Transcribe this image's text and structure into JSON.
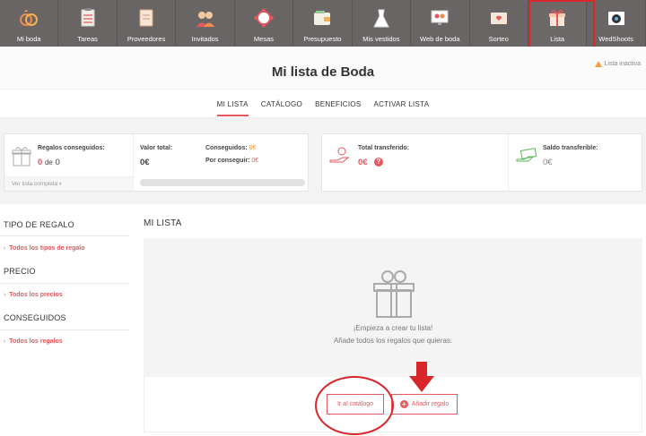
{
  "nav": {
    "items": [
      {
        "label": "Mi boda",
        "icon": "rings-icon"
      },
      {
        "label": "Tareas",
        "icon": "checklist-icon"
      },
      {
        "label": "Proveedores",
        "icon": "notebook-icon"
      },
      {
        "label": "Invitados",
        "icon": "guests-icon"
      },
      {
        "label": "Mesas",
        "icon": "table-icon"
      },
      {
        "label": "Presupuesto",
        "icon": "wallet-icon"
      },
      {
        "label": "Mis vestidos",
        "icon": "dress-icon"
      },
      {
        "label": "Web de boda",
        "icon": "website-icon"
      },
      {
        "label": "Sorteo",
        "icon": "ticket-icon"
      },
      {
        "label": "Lista",
        "icon": "gift-icon",
        "active": true
      },
      {
        "label": "WedShoots",
        "icon": "camera-icon"
      }
    ]
  },
  "header": {
    "title": "Mi lista de Boda",
    "status": "Lista inactiva"
  },
  "tabs": [
    "MI LISTA",
    "CATÁLOGO",
    "BENEFICIOS",
    "ACTIVAR LISTA"
  ],
  "stats": {
    "gifts_label": "Regalos conseguidos:",
    "gifts_count": "0",
    "gifts_of": "de",
    "gifts_total": "0",
    "see_full": "Ver lista completa",
    "total_label": "Valor total:",
    "total_value": "0€",
    "achieved_label": "Conseguidos:",
    "achieved_value": "0€",
    "pending_label": "Por conseguir:",
    "pending_value": "0€",
    "progress": 0,
    "transferred_label": "Total transferido:",
    "transferred_value": "0€",
    "transferable_label": "Saldo transferible:",
    "transferable_value": "0€"
  },
  "sidebar": {
    "sections": [
      {
        "title": "TIPO DE REGALO",
        "link": "Todos los tipos de regalo"
      },
      {
        "title": "PRECIO",
        "link": "Todos los precios"
      },
      {
        "title": "CONSEGUIDOS",
        "link": "Todos los regalos"
      }
    ]
  },
  "main": {
    "title": "MI LISTA",
    "empty_line1": "¡Empieza a crear tu lista!",
    "empty_line2": "Añade todos los regalos que quieras.",
    "catalog_button": "Ir al catálogo",
    "add_button": "Añadir regalo"
  },
  "colors": {
    "accent": "#e4585e",
    "nav_bg": "#6a6565",
    "annotation": "#d9262b"
  }
}
